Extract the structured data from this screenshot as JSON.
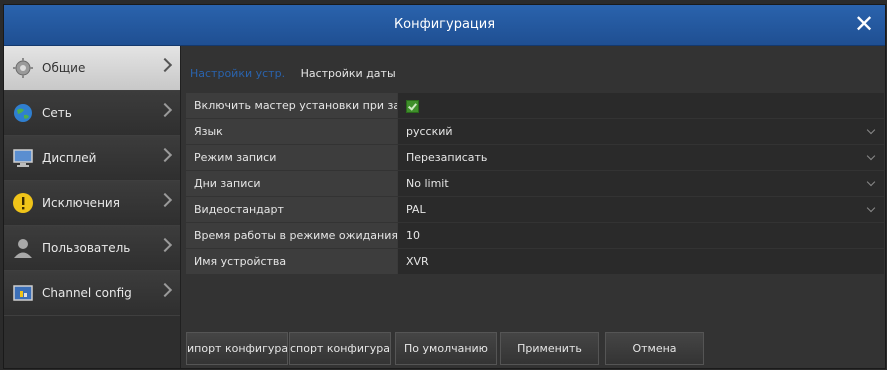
{
  "window": {
    "title": "Конфигурация"
  },
  "sidebar": {
    "items": [
      {
        "label": "Общие",
        "icon": "gear-icon",
        "active": true
      },
      {
        "label": "Сеть",
        "icon": "globe-icon",
        "active": false
      },
      {
        "label": "Дисплей",
        "icon": "monitor-icon",
        "active": false
      },
      {
        "label": "Исключения",
        "icon": "warning-icon",
        "active": false
      },
      {
        "label": "Пользователь",
        "icon": "user-icon",
        "active": false
      },
      {
        "label": "Channel config",
        "icon": "channel-config-icon",
        "active": false
      }
    ]
  },
  "tabs": [
    {
      "label": "Настройки устр.",
      "active": true
    },
    {
      "label": "Настройки даты",
      "active": false
    }
  ],
  "form": {
    "rows": [
      {
        "label": "Включить мастер установки при запу",
        "value": "",
        "type": "checkbox",
        "checked": true
      },
      {
        "label": "Язык",
        "value": "русский",
        "type": "select"
      },
      {
        "label": "Режим записи",
        "value": "Перезаписать",
        "type": "select"
      },
      {
        "label": "Дни записи",
        "value": "No limit",
        "type": "select"
      },
      {
        "label": "Видеостандарт",
        "value": "PAL",
        "type": "select"
      },
      {
        "label": "Время работы в режиме ожидания (м",
        "value": "10",
        "type": "text"
      },
      {
        "label": "Имя устройства",
        "value": "XVR",
        "type": "text"
      }
    ]
  },
  "buttons": {
    "import": "ипорт конфигурац",
    "export": "спорт конфигурац",
    "default": "По умолчанию",
    "apply": "Применить",
    "cancel": "Отмена"
  },
  "colors": {
    "titlebar": "#2a63ad",
    "active_tab": "#2a63ad",
    "checkbox": "#3f8f2b",
    "warning": "#f0c419"
  }
}
